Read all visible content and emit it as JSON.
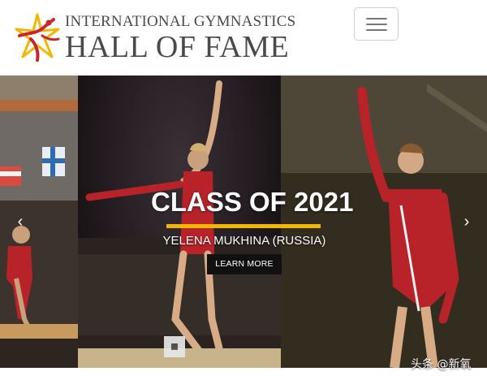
{
  "header": {
    "logo_line1": "INTERNATIONAL GYMNASTICS",
    "logo_line2": "HALL OF FAME",
    "logo_icon": "gymnast-star-logo",
    "menu_icon": "hamburger-menu-icon"
  },
  "carousel": {
    "title": "CLASS OF 2021",
    "subtitle": "YELENA MUKHINA (RUSSIA)",
    "cta_label": "LEARN MORE",
    "prev_icon": "chevron-left-icon",
    "next_icon": "chevron-right-icon",
    "prev_glyph": "‹",
    "next_glyph": "›"
  },
  "watermark": "头条 @新氧",
  "colors": {
    "accent_rule": "#f2b705",
    "logo_red": "#c8262d",
    "logo_gold": "#f2b705",
    "text_gray": "#4a4a4a"
  }
}
